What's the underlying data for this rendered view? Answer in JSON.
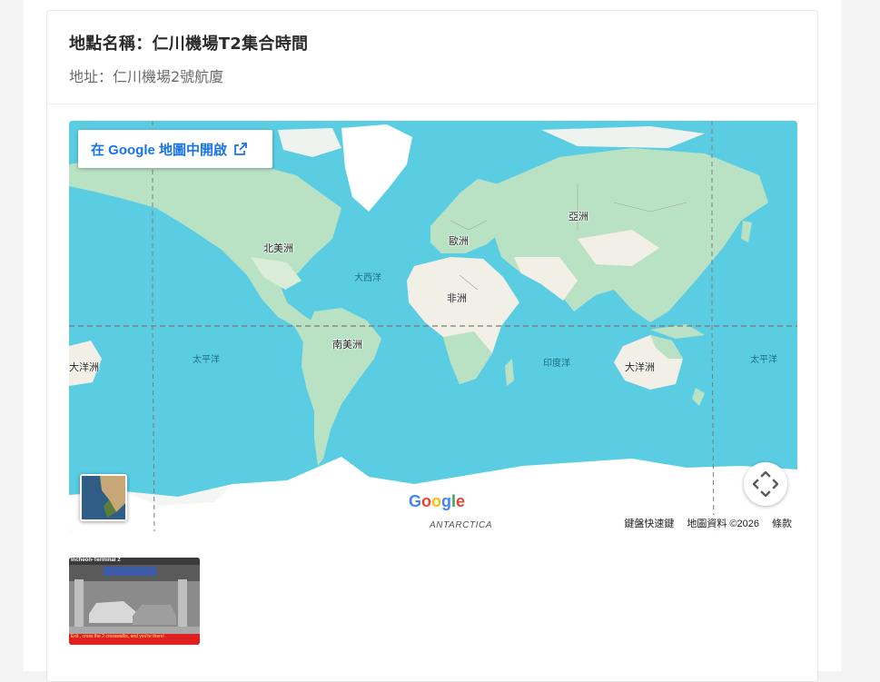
{
  "place": {
    "title": "地點名稱：仁川機場T2集合時間",
    "address": "地址：仁川機場2號航廈"
  },
  "map": {
    "open_in_google_maps": "在 Google 地圖中開啟",
    "continents": {
      "north_america": "北美洲",
      "south_america": "南美洲",
      "europe": "歐洲",
      "africa": "非洲",
      "asia": "亞洲",
      "oceania_left": "大洋洲",
      "oceania_right": "大洋洲",
      "antarctica": "ANTARCTICA"
    },
    "oceans": {
      "atlantic": "大西洋",
      "pacific_left": "太平洋",
      "pacific_right": "太平洋",
      "indian": "印度洋"
    },
    "attribution": {
      "keyboard_shortcuts": "鍵盤快速鍵",
      "map_data": "地圖資料 ©2026",
      "terms": "條款"
    },
    "logo_text": "Google",
    "colors": {
      "ocean": "#5bcde3",
      "land": "#b9e2c4",
      "desert": "#f1efe6",
      "ice": "#ffffff",
      "link": "#1a73e8"
    }
  },
  "photo": {
    "header_text": "Incheon-Terminal 2",
    "caption": "Exit , cross the 2 crosswalks, and you're there!"
  }
}
